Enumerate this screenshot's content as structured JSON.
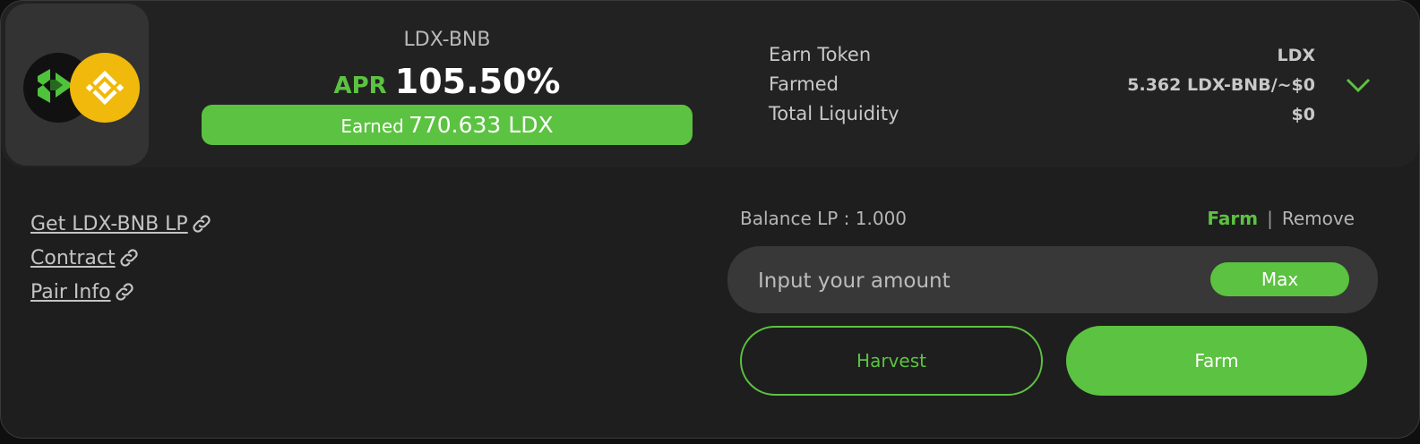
{
  "farm": {
    "pair_name": "LDX-BNB",
    "apr_label": "APR",
    "apr_value": "105.50%",
    "earned_label": "Earned",
    "earned_value": "770.633 LDX",
    "token_a_icon": "ldx-logo-icon",
    "token_b_icon": "bnb-logo-icon"
  },
  "info": {
    "earn_token_label": "Earn Token",
    "earn_token_value": "LDX",
    "farmed_label": "Farmed",
    "farmed_value": "5.362 LDX-BNB/~$0",
    "total_liquidity_label": "Total Liquidity",
    "total_liquidity_value": "$0",
    "expand_icon": "chevron-down-icon"
  },
  "links": {
    "get_lp": "Get LDX-BNB LP",
    "contract": "Contract",
    "pair_info": "Pair Info",
    "icon": "link-icon"
  },
  "action": {
    "balance": "Balance LP : 1.000",
    "tab_farm": "Farm",
    "tab_separator": "|",
    "tab_remove": "Remove",
    "amount_placeholder": "Input your amount",
    "amount_value": "",
    "max_label": "Max",
    "harvest_label": "Harvest",
    "farm_label": "Farm"
  },
  "colors": {
    "accent": "#5cc241",
    "card_background": "#1e1e1e",
    "header_background": "#222222",
    "bnb_yellow": "#f0b90b"
  }
}
